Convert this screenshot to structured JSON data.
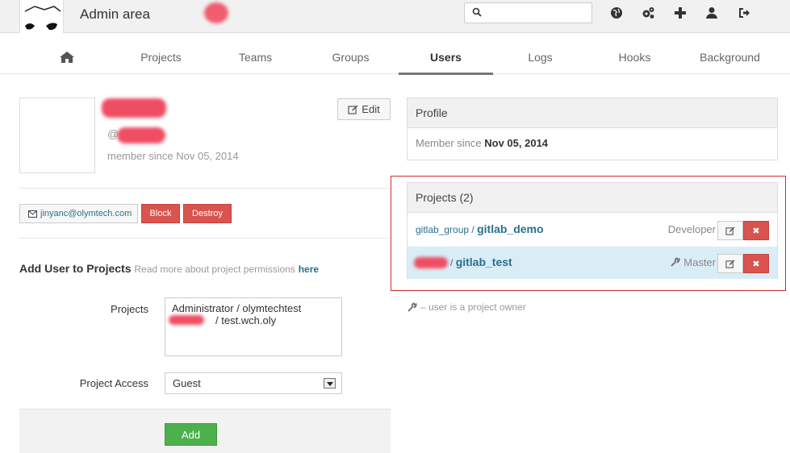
{
  "header": {
    "title": "Admin area",
    "search_placeholder": "",
    "icons": [
      "globe-icon",
      "gears-icon",
      "plus-icon",
      "user-icon",
      "sign-out-icon"
    ]
  },
  "nav": {
    "tabs": [
      {
        "label": "",
        "icon": "home-icon"
      },
      {
        "label": "Projects"
      },
      {
        "label": "Teams"
      },
      {
        "label": "Groups"
      },
      {
        "label": "Users",
        "active": true
      },
      {
        "label": "Logs"
      },
      {
        "label": "Hooks"
      },
      {
        "label": "Background"
      }
    ]
  },
  "user": {
    "at_symbol": "@",
    "member_since": "member since Nov 05, 2014",
    "edit_label": "Edit",
    "email": "jinyanc@olymtech.com",
    "block_label": "Block",
    "destroy_label": "Destroy"
  },
  "add_projects": {
    "title": "Add User to Projects",
    "hint": "Read more about project permissions",
    "link": "here",
    "projects_label": "Projects",
    "project_options": [
      "Administrator / olymtechtest",
      "/ test.wch.oly"
    ],
    "access_label": "Project Access",
    "access_value": "Guest",
    "add_label": "Add"
  },
  "profile_panel": {
    "title": "Profile",
    "member_since_prefix": "Member since",
    "member_since_date": "Nov 05, 2014"
  },
  "projects_panel": {
    "title": "Projects (2)",
    "rows": [
      {
        "namespace": "gitlab_group",
        "separator": "/",
        "name": "gitlab_demo",
        "role": "Developer"
      },
      {
        "namespace": "",
        "separator": "/",
        "name": "gitlab_test",
        "role": "Master"
      }
    ]
  },
  "owner_note": "– user is a project owner",
  "colors": {
    "danger": "#d9534f",
    "success": "#4cb04c",
    "link": "#2a6f8f",
    "highlight": "#c9302c"
  }
}
